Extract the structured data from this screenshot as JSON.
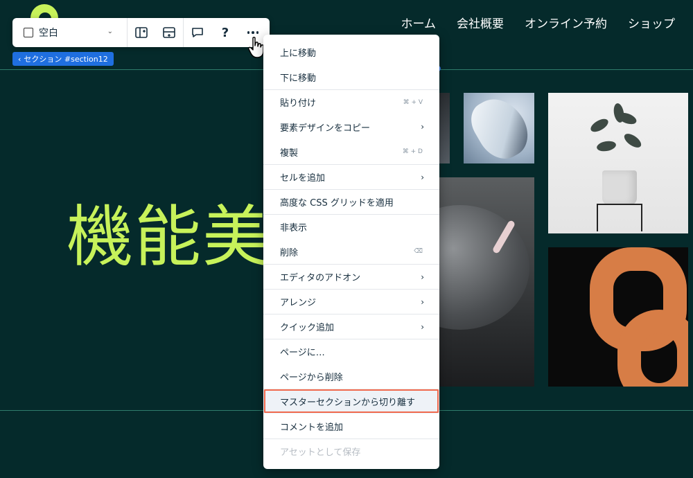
{
  "site": {
    "nav": [
      "ホーム",
      "会社概要",
      "オンライン予約",
      "ショップ"
    ],
    "hero_text": "機能美"
  },
  "toolbar": {
    "select_label": "空白",
    "buttons": [
      "layout-icon",
      "add-section-icon",
      "comment-icon",
      "help-icon",
      "more-icon"
    ]
  },
  "section_tag": {
    "label": "セクション #section12"
  },
  "menu": {
    "items": [
      {
        "label": "上に移動",
        "shortcut": "",
        "submenu": false,
        "disabled": false
      },
      {
        "label": "下に移動",
        "shortcut": "",
        "submenu": false,
        "disabled": false
      },
      {
        "label": "貼り付け",
        "shortcut": "⌘ + V",
        "submenu": false,
        "disabled": false
      },
      {
        "label": "要素デザインをコピー",
        "shortcut": "",
        "submenu": true,
        "disabled": false
      },
      {
        "label": "複製",
        "shortcut": "⌘ + D",
        "submenu": false,
        "disabled": false
      },
      {
        "label": "セルを追加",
        "shortcut": "",
        "submenu": true,
        "disabled": false
      },
      {
        "label": "高度な CSS グリッドを適用",
        "shortcut": "",
        "submenu": false,
        "disabled": false
      },
      {
        "label": "非表示",
        "shortcut": "",
        "submenu": false,
        "disabled": false
      },
      {
        "label": "削除",
        "shortcut": "⌫",
        "submenu": false,
        "disabled": false
      },
      {
        "label": "エディタのアドオン",
        "shortcut": "",
        "submenu": true,
        "disabled": false
      },
      {
        "label": "アレンジ",
        "shortcut": "",
        "submenu": true,
        "disabled": false
      },
      {
        "label": "クイック追加",
        "shortcut": "",
        "submenu": true,
        "disabled": false
      },
      {
        "label": "ページに…",
        "shortcut": "",
        "submenu": false,
        "disabled": false
      },
      {
        "label": "ページから削除",
        "shortcut": "",
        "submenu": false,
        "disabled": false
      },
      {
        "label": "マスターセクションから切り離す",
        "shortcut": "",
        "submenu": false,
        "disabled": false
      },
      {
        "label": "コメントを追加",
        "shortcut": "",
        "submenu": false,
        "disabled": false
      },
      {
        "label": "アセットとして保存",
        "shortcut": "",
        "submenu": false,
        "disabled": true
      }
    ]
  },
  "colors": {
    "background": "#052a2b",
    "accent_green": "#c7f25a",
    "tag_blue": "#1f6fe0",
    "highlight": "#f0694d"
  }
}
